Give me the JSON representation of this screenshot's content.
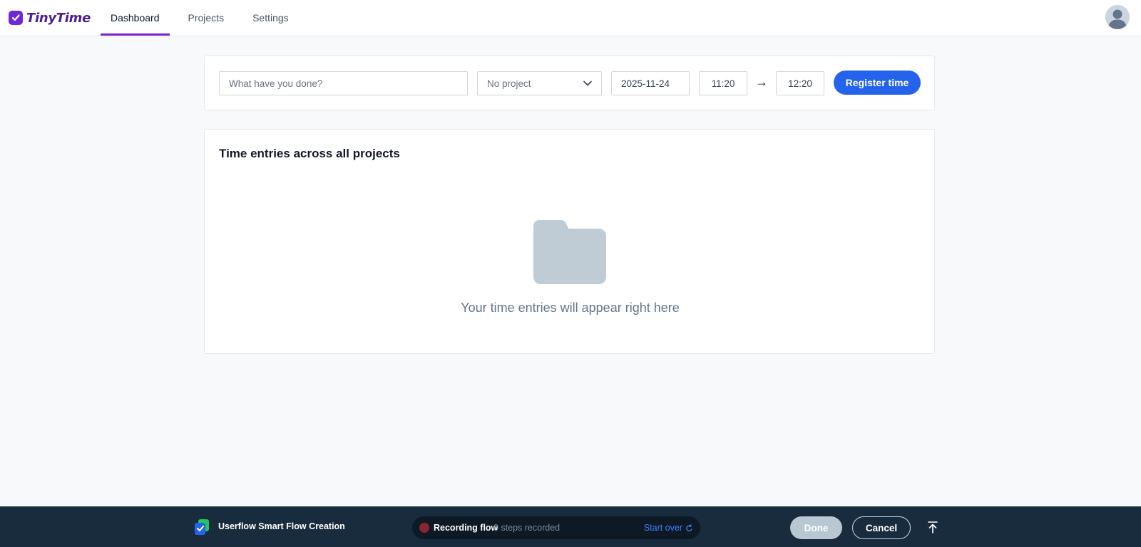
{
  "app": {
    "name": "TinyTime",
    "brand_color": "#6d28d9"
  },
  "nav": {
    "tabs": [
      {
        "label": "Dashboard",
        "active": true
      },
      {
        "label": "Projects",
        "active": false
      },
      {
        "label": "Settings",
        "active": false
      }
    ],
    "active_color": "#7e22ce"
  },
  "entry_form": {
    "description_placeholder": "What have you done?",
    "description_value": "",
    "project_selected": "No project",
    "date": "2025-11-24",
    "start_time": "11:20",
    "arrow": "→",
    "end_time": "12:20",
    "register_label": "Register time",
    "register_color": "#2563eb"
  },
  "entries": {
    "title": "Time entries across all projects",
    "empty_message": "Your time entries will appear right here",
    "empty_icon": "folder-icon"
  },
  "recorder": {
    "title": "Userflow Smart Flow Creation",
    "status_label": "Recording flow",
    "steps_text": "0 steps recorded",
    "start_over_label": "Start over",
    "done_label": "Done",
    "cancel_label": "Cancel",
    "bar_color": "#182c3d"
  }
}
